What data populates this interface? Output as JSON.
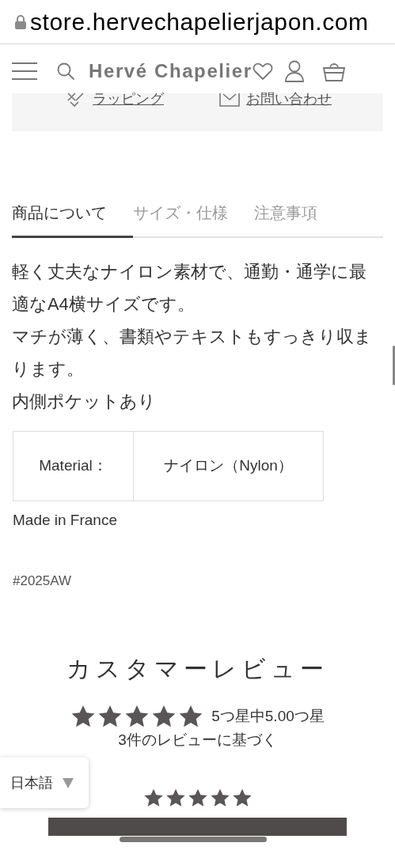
{
  "address_bar": {
    "url": "store.hervechapelierjapon.com"
  },
  "header": {
    "logo": "Hervé Chapelier"
  },
  "service_links": [
    {
      "kind": "wrapping",
      "label": "ラッピング"
    },
    {
      "kind": "contact",
      "label": "お問い合わせ"
    }
  ],
  "tabs": [
    {
      "label": "商品について",
      "selected": true
    },
    {
      "label": "サイズ・仕様",
      "selected": false
    },
    {
      "label": "注意事項",
      "selected": false
    }
  ],
  "description": [
    "軽く丈夫なナイロン素材で、通勤・通学に最適なA4横サイズです。",
    "マチが薄く、書類やテキストもすっきり収まります。",
    "内側ポケットあり"
  ],
  "spec_table": [
    {
      "label": "Material：",
      "value": "ナイロン（Nylon）"
    }
  ],
  "origin": "Made in France",
  "tag": "#2025AW",
  "reviews": {
    "title": "カスタマーレビュー",
    "stars": 5,
    "summary": "5つ星中5.00つ星",
    "based_on": "3件のレビューに基づく"
  },
  "review_list": [
    {
      "stars": 5
    }
  ],
  "language_selector": {
    "value": "日本語"
  }
}
